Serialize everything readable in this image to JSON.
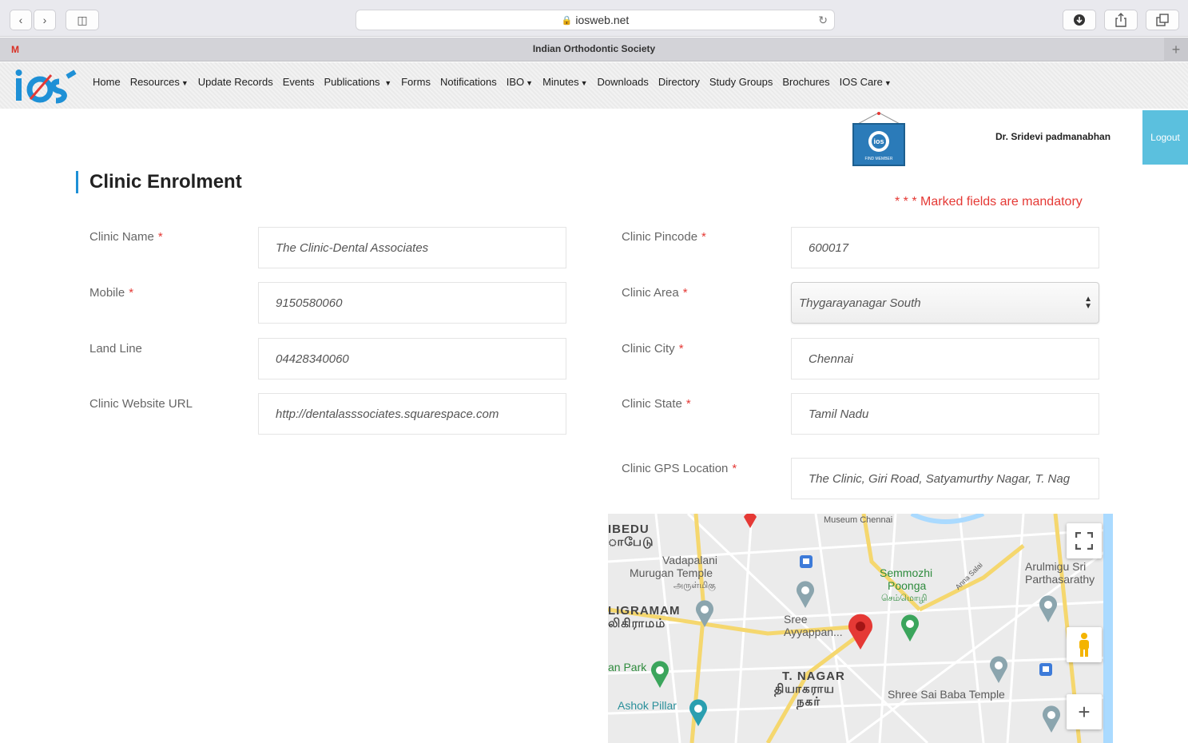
{
  "browser": {
    "url": "iosweb.net",
    "tab_title": "Indian Orthodontic Society",
    "gmail_label": "M"
  },
  "nav": {
    "items": [
      "Home",
      "Resources",
      "Update Records",
      "Events",
      "Publications",
      "Forms",
      "Notifications",
      "IBO",
      "Minutes",
      "Downloads",
      "Directory",
      "Study Groups",
      "Brochures",
      "IOS Care"
    ],
    "dropdown_items": [
      "Resources",
      "Publications",
      "IBO",
      "Minutes",
      "IOS Care"
    ]
  },
  "header": {
    "user_name": "Dr. Sridevi padmanabhan",
    "logout_label": "Logout",
    "badge_text": "FIND MEMBER"
  },
  "page": {
    "title": "Clinic Enrolment",
    "mandatory_note": "* * * Marked fields are mandatory"
  },
  "form": {
    "clinic_name": {
      "label": "Clinic Name",
      "value": "The Clinic-Dental Associates",
      "required": true
    },
    "mobile": {
      "label": "Mobile",
      "value": "9150580060",
      "required": true
    },
    "land_line": {
      "label": "Land Line",
      "value": "04428340060",
      "required": false
    },
    "website": {
      "label": "Clinic Website URL",
      "value": "http://dentalasssociates.squarespace.com",
      "required": false
    },
    "pincode": {
      "label": "Clinic Pincode",
      "value": "600017",
      "required": true
    },
    "area": {
      "label": "Clinic Area",
      "value": "Thygarayanagar South",
      "required": true
    },
    "city": {
      "label": "Clinic City",
      "value": "Chennai",
      "required": true
    },
    "state": {
      "label": "Clinic State",
      "value": "Tamil Nadu",
      "required": true
    },
    "gps": {
      "label": "Clinic GPS Location",
      "value": "The Clinic, Giri Road, Satyamurthy Nagar, T. Nag",
      "required": true
    }
  },
  "map": {
    "labels": {
      "ibedu": "IBEDU",
      "ibedu_ta": "ாபேடு",
      "vadapalani": "Vadapalani",
      "murugan_temple": "Murugan Temple",
      "murugan_ta": "அருள்மிகு",
      "ligramam": "LIGRAMAM",
      "ligramam_ta": "லிகிராமம்",
      "semmozhi": "Semmozhi",
      "poonga": "Poonga",
      "semmozhi_ta": "செம்மொழி",
      "arulmigu": "Arulmigu Sri",
      "parthasarathy": "Parthasarathy",
      "sree": "Sree",
      "ayyappan": "Ayyappan...",
      "t_nagar": "T. NAGAR",
      "t_nagar_ta": "தியாகராய",
      "t_nagar_ta2": "நகர்",
      "park": "an Park",
      "ashok_pillar": "Ashok Pillar",
      "shree_sai_baba": "Shree Sai Baba Temple",
      "museum": "Museum Chennai",
      "anna_salai": "Anna Salai"
    },
    "fullscreen_icon": "fullscreen-icon",
    "zoom_in_label": "+",
    "pegman_icon": "pegman-icon"
  },
  "colors": {
    "accent_blue": "#1e90d6",
    "logout_bg": "#5bc0de",
    "required_red": "#e53935"
  }
}
